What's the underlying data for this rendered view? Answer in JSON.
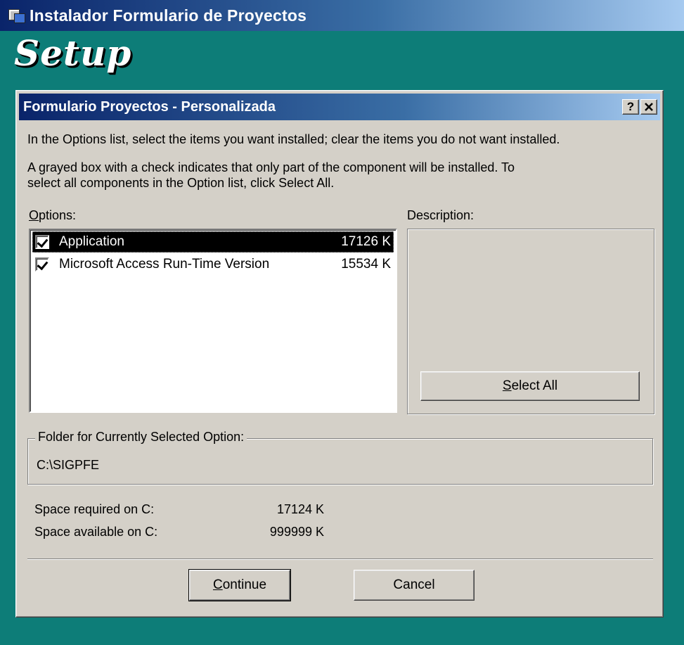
{
  "outer_window": {
    "title": "Instalador Formulario de Proyectos",
    "heading": "Setup"
  },
  "dialog": {
    "title": "Formulario Proyectos - Personalizada",
    "help_button": "?",
    "close_button": "✕",
    "instruction_1": "In the Options list, select the items you want installed; clear the items you do not want installed.",
    "instruction_2_line1": "A grayed box with a check indicates that only part of the component will be installed. To",
    "instruction_2_line2": "select all components in the Option list, click Select All.",
    "options_label_accel": "O",
    "options_label_rest": "ptions:",
    "description_label": "Description:",
    "options": [
      {
        "label": "Application",
        "size": "17126 K",
        "checked": true,
        "selected": true
      },
      {
        "label": "Microsoft Access Run-Time Version",
        "size": "15534 K",
        "checked": true,
        "selected": false
      }
    ],
    "select_all_accel": "S",
    "select_all_rest": "elect All",
    "folder_group_label": "Folder for Currently Selected Option:",
    "folder_path": "C:\\SIGPFE",
    "space_required_label": "Space required on C:",
    "space_required_value": "17124 K",
    "space_available_label": "Space available on C:",
    "space_available_value": "999999 K",
    "continue_accel": "C",
    "continue_rest": "ontinue",
    "cancel_label": "Cancel"
  },
  "colors": {
    "desktop": "#0d7d78",
    "title_gradient_start": "#0a246a",
    "title_gradient_end": "#a6caf0",
    "dialog_face": "#d4d0c8"
  }
}
